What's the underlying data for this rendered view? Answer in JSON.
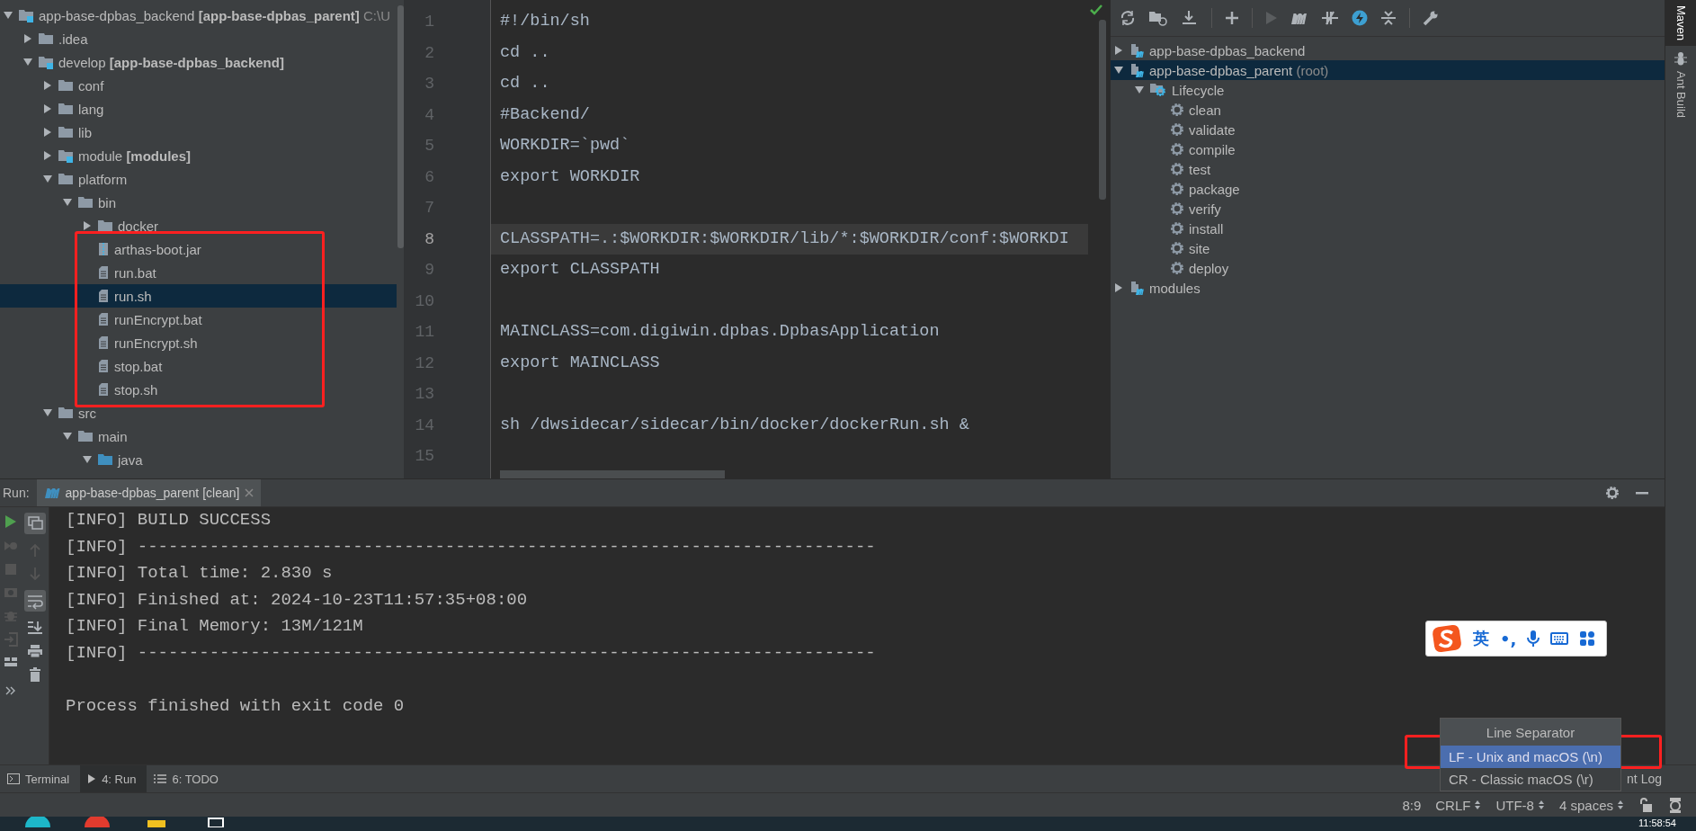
{
  "project_tree": {
    "items": [
      {
        "label": "app-base-dpbas_backend",
        "module": "[app-base-dpbas_parent]",
        "path": "C:\\U",
        "kind": "module",
        "expanded": true,
        "selected": false,
        "children": [
          {
            "label": ".idea",
            "kind": "folder",
            "expanded": false,
            "selected": false
          },
          {
            "label": "develop",
            "module": "[app-base-dpbas_backend]",
            "kind": "module",
            "expanded": true,
            "selected": false,
            "children": [
              {
                "label": "conf",
                "kind": "folder",
                "expanded": false,
                "selected": false
              },
              {
                "label": "lang",
                "kind": "folder",
                "expanded": false,
                "selected": false
              },
              {
                "label": "lib",
                "kind": "folder",
                "expanded": false,
                "selected": false
              },
              {
                "label": "module",
                "module": "[modules]",
                "kind": "module",
                "expanded": false,
                "selected": false
              },
              {
                "label": "platform",
                "kind": "folder",
                "expanded": true,
                "selected": false,
                "children": [
                  {
                    "label": "bin",
                    "kind": "folder",
                    "expanded": true,
                    "selected": false,
                    "children": [
                      {
                        "label": "docker",
                        "kind": "folder",
                        "expanded": false,
                        "selected": false
                      },
                      {
                        "label": "arthas-boot.jar",
                        "kind": "jar",
                        "selected": false
                      },
                      {
                        "label": "run.bat",
                        "kind": "file",
                        "selected": false
                      },
                      {
                        "label": "run.sh",
                        "kind": "file",
                        "selected": true
                      },
                      {
                        "label": "runEncrypt.bat",
                        "kind": "file",
                        "selected": false
                      },
                      {
                        "label": "runEncrypt.sh",
                        "kind": "file",
                        "selected": false
                      },
                      {
                        "label": "stop.bat",
                        "kind": "file",
                        "selected": false
                      },
                      {
                        "label": "stop.sh",
                        "kind": "file",
                        "selected": false
                      }
                    ]
                  }
                ]
              },
              {
                "label": "src",
                "kind": "folder",
                "expanded": true,
                "selected": false,
                "children": [
                  {
                    "label": "main",
                    "kind": "folder",
                    "expanded": true,
                    "selected": false,
                    "children": [
                      {
                        "label": "java",
                        "kind": "source",
                        "expanded": true,
                        "selected": false
                      }
                    ]
                  }
                ]
              }
            ]
          }
        ]
      }
    ]
  },
  "editor": {
    "lines": [
      {
        "number": "1",
        "code": "#!/bin/sh",
        "selected": false
      },
      {
        "number": "2",
        "code": "cd ..",
        "selected": false
      },
      {
        "number": "3",
        "code": "cd ..",
        "selected": false
      },
      {
        "number": "4",
        "code": "#Backend/",
        "selected": false
      },
      {
        "number": "5",
        "code": "WORKDIR=`pwd`",
        "selected": false
      },
      {
        "number": "6",
        "code": "export WORKDIR",
        "selected": false
      },
      {
        "number": "7",
        "selected": false
      },
      {
        "number": "8",
        "code": "CLASSPATH=.:$WORKDIR:$WORKDIR/lib/*:$WORKDIR/conf:$WORKDI",
        "selected": true
      },
      {
        "number": "9",
        "code": "export CLASSPATH",
        "selected": false
      },
      {
        "number": "10",
        "selected": false
      },
      {
        "number": "11",
        "code": "MAINCLASS=com.digiwin.dpbas.DpbasApplication",
        "selected": false
      },
      {
        "number": "12",
        "code": "export MAINCLASS",
        "selected": false
      },
      {
        "number": "13",
        "selected": false
      },
      {
        "number": "14",
        "code": "sh /dwsidecar/sidecar/bin/docker/dockerRun.sh &",
        "selected": false
      },
      {
        "number": "15",
        "selected": false
      }
    ]
  },
  "maven": {
    "items": [
      {
        "label": "app-base-dpbas_backend",
        "kind": "project",
        "expanded": false,
        "selected": false
      },
      {
        "label": "app-base-dpbas_parent",
        "note": "(root)",
        "kind": "project",
        "expanded": true,
        "selected": true,
        "children": [
          {
            "label": "Lifecycle",
            "kind": "lifecycle",
            "expanded": true,
            "selected": false,
            "children": [
              {
                "label": "clean",
                "kind": "goal",
                "selected": false
              },
              {
                "label": "validate",
                "kind": "goal",
                "selected": false
              },
              {
                "label": "compile",
                "kind": "goal",
                "selected": false
              },
              {
                "label": "test",
                "kind": "goal",
                "selected": false
              },
              {
                "label": "package",
                "kind": "goal",
                "selected": false
              },
              {
                "label": "verify",
                "kind": "goal",
                "selected": false
              },
              {
                "label": "install",
                "kind": "goal",
                "selected": false
              },
              {
                "label": "site",
                "kind": "goal",
                "selected": false
              },
              {
                "label": "deploy",
                "kind": "goal",
                "selected": false
              }
            ]
          }
        ]
      },
      {
        "label": "modules",
        "kind": "project",
        "expanded": false,
        "selected": false
      }
    ]
  },
  "side_tabs": [
    {
      "label": "Maven",
      "kind": "maven",
      "selected": true
    },
    {
      "label": "Ant Build",
      "kind": "ant",
      "selected": false
    }
  ],
  "run_panel": {
    "label": "Run:",
    "tab": "app-base-dpbas_parent [clean]",
    "console": [
      "[INFO] BUILD SUCCESS",
      "[INFO] ------------------------------------------------------------------------",
      "[INFO] Total time: 2.830 s",
      "[INFO] Finished at: 2024-10-23T11:57:35+08:00",
      "[INFO] Final Memory: 13M/121M",
      "[INFO] ------------------------------------------------------------------------"
    ],
    "exit_message": "Process finished with exit code 0"
  },
  "ime_bar": {
    "language": "英",
    "punctuation": "•,"
  },
  "line_separator_popup": {
    "title": "Line Separator",
    "options": [
      {
        "label": "LF - Unix and macOS (\\n)",
        "selected": true
      },
      {
        "label": "CR - Classic macOS (\\r)",
        "selected": false
      }
    ]
  },
  "tool_tabs": [
    {
      "label": "Terminal",
      "kind": "terminal",
      "selected": false
    },
    {
      "label": "4: Run",
      "kind": "run",
      "selected": true
    },
    {
      "label": "6: TODO",
      "kind": "todo",
      "selected": false
    }
  ],
  "event_log": "nt Log",
  "status_bar": [
    {
      "text": "8:9",
      "dropdown": false
    },
    {
      "text": "CRLF",
      "dropdown": true
    },
    {
      "text": "UTF-8",
      "dropdown": true
    },
    {
      "text": "4 spaces",
      "dropdown": true
    }
  ],
  "taskbar": {
    "clock": "11:58:54"
  }
}
